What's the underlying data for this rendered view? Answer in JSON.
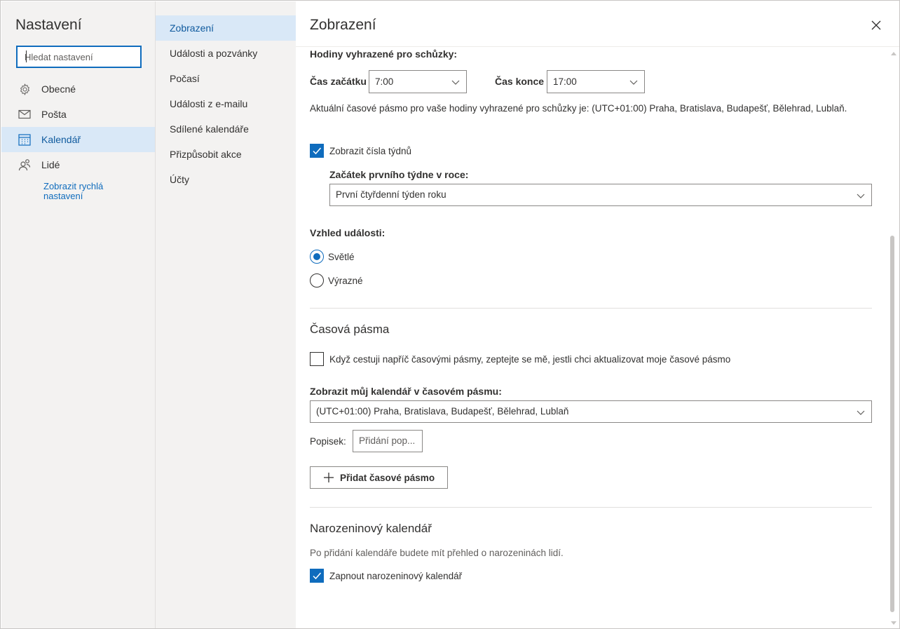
{
  "left_nav": {
    "title": "Nastavení",
    "search_placeholder": "Hledat nastavení",
    "items": [
      {
        "label": "Obecné",
        "icon": "gear-icon"
      },
      {
        "label": "Pošta",
        "icon": "mail-icon"
      },
      {
        "label": "Kalendář",
        "icon": "calendar-icon"
      },
      {
        "label": "Lidé",
        "icon": "people-icon"
      }
    ],
    "active_index": 2,
    "quick_settings_link": "Zobrazit rychlá nastavení"
  },
  "sub_nav": {
    "items": [
      "Zobrazení",
      "Události a pozvánky",
      "Počasí",
      "Události z e-mailu",
      "Sdílené kalendáře",
      "Přizpůsobit akce",
      "Účty"
    ],
    "active_index": 0
  },
  "pane": {
    "title": "Zobrazení",
    "meeting_hours": {
      "heading": "Hodiny vyhrazené pro schůzky:",
      "start_label": "Čas začátku",
      "start_value": "7:00",
      "end_label": "Čas konce",
      "end_value": "17:00",
      "timezone_note": "Aktuální časové pásmo pro vaše hodiny vyhrazené pro schůzky je: (UTC+01:00) Praha, Bratislava, Budapešť, Bělehrad, Lublaň."
    },
    "week_numbers": {
      "checkbox_label": "Zobrazit čísla týdnů",
      "checked": true,
      "first_week_label": "Začátek prvního týdne v roce:",
      "first_week_value": "První čtyřdenní týden roku"
    },
    "event_appearance": {
      "heading": "Vzhled události:",
      "options": [
        "Světlé",
        "Výrazné"
      ],
      "selected": "Světlé"
    },
    "time_zones": {
      "heading": "Časová pásma",
      "travel_checkbox_label": "Když cestuji napříč časovými pásmy, zeptejte se mě, jestli chci aktualizovat moje časové pásmo",
      "travel_checked": false,
      "display_label": "Zobrazit můj kalendář v časovém pásmu:",
      "display_value": "(UTC+01:00) Praha, Bratislava, Budapešť, Bělehrad, Lublaň",
      "caption_label": "Popisek:",
      "caption_placeholder": "Přidání pop...",
      "add_button": "Přidat časové pásmo"
    },
    "birthday": {
      "heading": "Narozeninový kalendář",
      "description": "Po přidání kalendáře budete mít přehled o narozeninách lidí.",
      "checkbox_label": "Zapnout narozeninový kalendář",
      "checked": true
    }
  },
  "colors": {
    "accent": "#0f6cbd",
    "nav_background": "#f3f2f1",
    "active_background": "#d9e8f7"
  }
}
